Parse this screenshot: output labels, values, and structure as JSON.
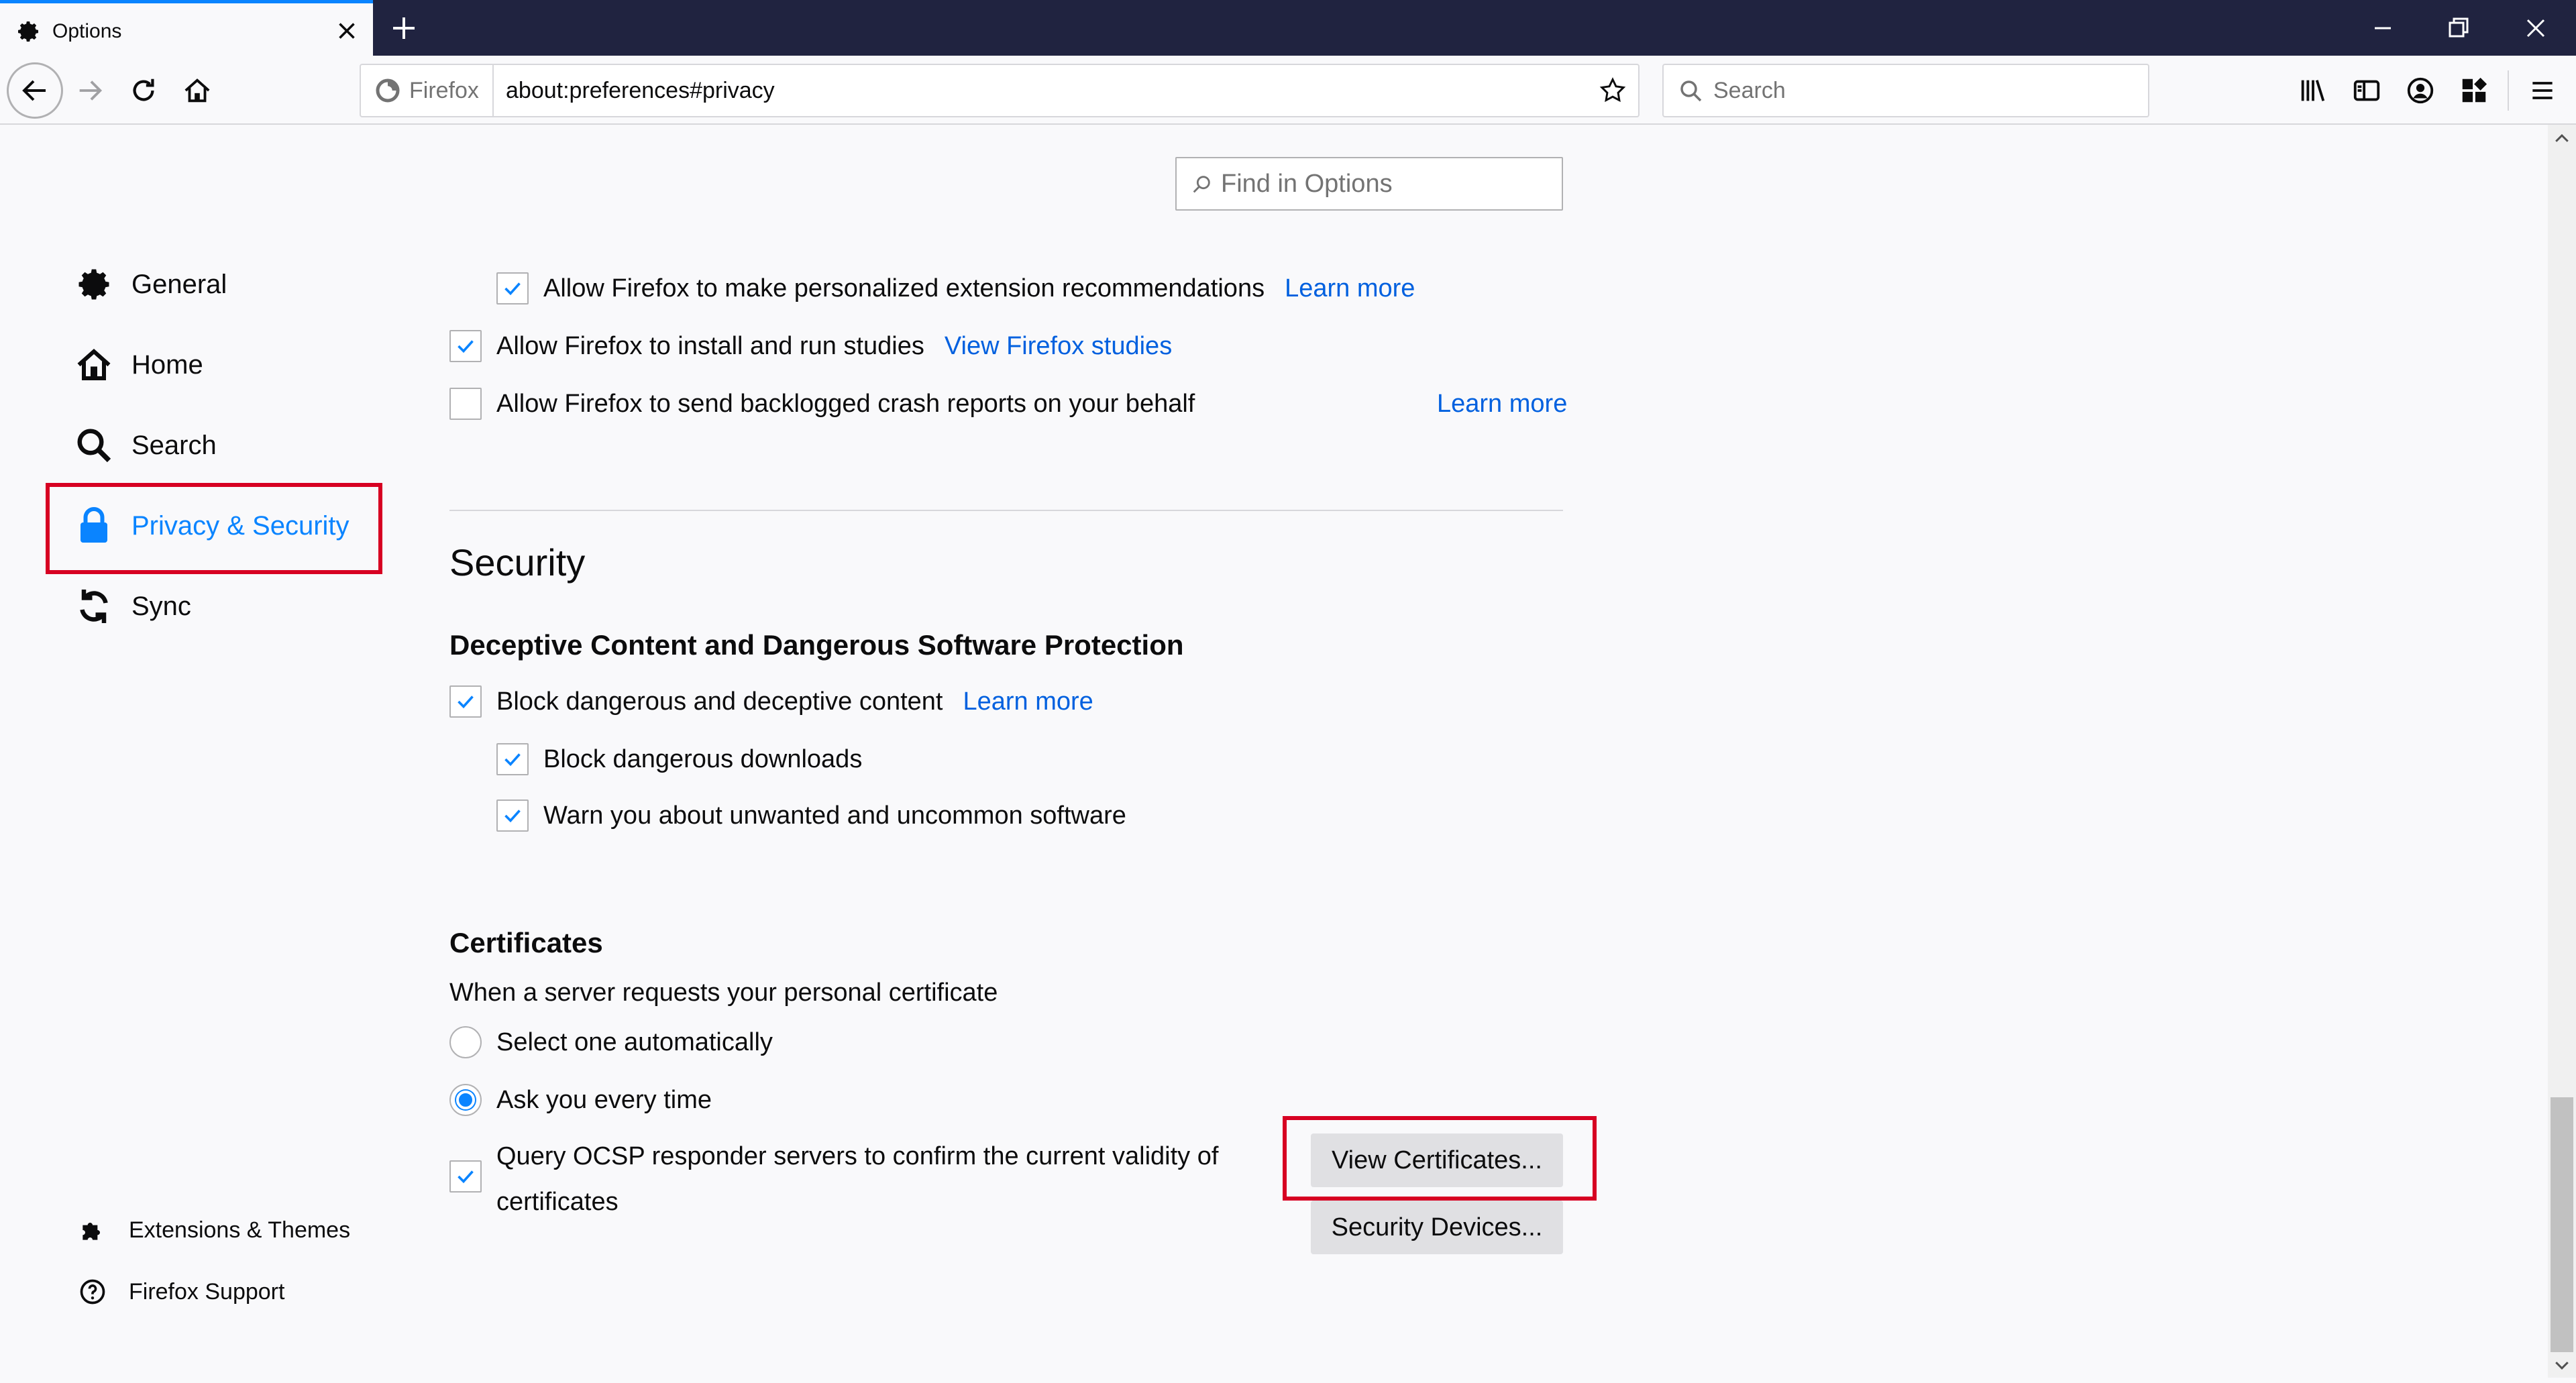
{
  "tab": {
    "title": "Options"
  },
  "urlbar": {
    "identity": "Firefox",
    "url": "about:preferences#privacy"
  },
  "search": {
    "placeholder": "Search"
  },
  "find": {
    "placeholder": "Find in Options"
  },
  "sidebar": {
    "items": [
      {
        "label": "General",
        "icon": "gear-icon"
      },
      {
        "label": "Home",
        "icon": "home-icon"
      },
      {
        "label": "Search",
        "icon": "search-icon"
      },
      {
        "label": "Privacy & Security",
        "icon": "lock-icon",
        "selected": true
      },
      {
        "label": "Sync",
        "icon": "sync-icon"
      }
    ],
    "footer": [
      {
        "label": "Extensions & Themes",
        "icon": "puzzle-icon"
      },
      {
        "label": "Firefox Support",
        "icon": "help-icon"
      }
    ]
  },
  "data_collection": {
    "rec_label": "Allow Firefox to make personalized extension recommendations",
    "rec_link": "Learn more",
    "studies_label": "Allow Firefox to install and run studies",
    "studies_link": "View Firefox studies",
    "crash_label": "Allow Firefox to send backlogged crash reports on your behalf",
    "crash_link": "Learn more"
  },
  "security": {
    "heading": "Security",
    "deceptive_heading": "Deceptive Content and Dangerous Software Protection",
    "block_label": "Block dangerous and deceptive content",
    "block_link": "Learn more",
    "downloads_label": "Block dangerous downloads",
    "unwanted_label": "Warn you about unwanted and uncommon software"
  },
  "certificates": {
    "heading": "Certificates",
    "description": "When a server requests your personal certificate",
    "auto_label": "Select one automatically",
    "ask_label": "Ask you every time",
    "ocsp_line1": "Query OCSP responder servers to confirm the current validity of",
    "ocsp_line2": "certificates",
    "view_button": "View Certificates...",
    "devices_button": "Security Devices..."
  },
  "colors": {
    "accent": "#0a84ff",
    "link": "#0060df",
    "highlight": "#d70022",
    "titlebar": "#202340"
  }
}
